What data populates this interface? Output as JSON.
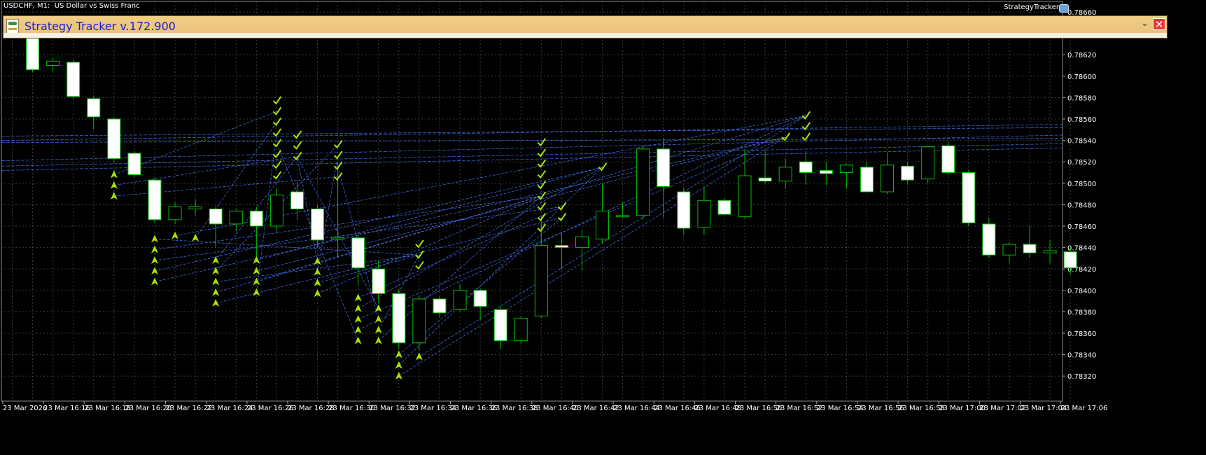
{
  "chart": {
    "symbol_label": "USDCHF, M1:  US Dollar vs Swiss Franc",
    "ea_name": "StrategyTracker",
    "ea_badge": "hat-icon"
  },
  "panel": {
    "title": "Strategy Tracker v.172.900",
    "collapse_icon": "chevron-down-icon",
    "close_icon": "close-icon",
    "close_glyph": "✕",
    "collapse_glyph": "⌄"
  },
  "colors": {
    "background": "#000000",
    "grid": "#3c3c3c",
    "bull_candle": "#00c000",
    "bear_candle": "#ffffff",
    "trade_lines": "#4a78ff",
    "markers": "#a8e400",
    "panel_bg": "#eec47f",
    "panel_title": "#1a1ad0",
    "close_button": "#e53935"
  },
  "chart_data": {
    "type": "candlestick",
    "instrument": "USDCHF",
    "timeframe": "M1",
    "ylim": [
      0.7831,
      0.7867
    ],
    "y_ticks": [
      "0.78660",
      "0.78640",
      "0.78620",
      "0.78600",
      "0.78580",
      "0.78560",
      "0.78540",
      "0.78520",
      "0.78500",
      "0.78480",
      "0.78460",
      "0.78440",
      "0.78420",
      "0.78400",
      "0.78380",
      "0.78360",
      "0.78340",
      "0.78320"
    ],
    "x_ticks": [
      "23 Mar 2026",
      "23 Mar 16:16",
      "23 Mar 16:18",
      "23 Mar 16:20",
      "23 Mar 16:22",
      "23 Mar 16:24",
      "23 Mar 16:26",
      "23 Mar 16:28",
      "23 Mar 16:30",
      "23 Mar 16:32",
      "23 Mar 16:34",
      "23 Mar 16:36",
      "23 Mar 16:38",
      "23 Mar 16:40",
      "23 Mar 16:42",
      "23 Mar 16:44",
      "23 Mar 16:46",
      "23 Mar 16:48",
      "23 Mar 16:50",
      "23 Mar 16:52",
      "23 Mar 16:54",
      "23 Mar 16:56",
      "23 Mar 16:58",
      "23 Mar 17:00",
      "23 Mar 17:02",
      "23 Mar 17:04",
      "23 Mar 17:06"
    ],
    "candles": [
      {
        "o": 0.78642,
        "h": 0.78648,
        "l": 0.78636,
        "c": 0.7864
      },
      {
        "o": 0.7864,
        "h": 0.78645,
        "l": 0.78604,
        "c": 0.78606
      },
      {
        "o": 0.7861,
        "h": 0.78617,
        "l": 0.78604,
        "c": 0.78614
      },
      {
        "o": 0.78613,
        "h": 0.78615,
        "l": 0.78579,
        "c": 0.78581
      },
      {
        "o": 0.78579,
        "h": 0.78582,
        "l": 0.7855,
        "c": 0.78562
      },
      {
        "o": 0.7856,
        "h": 0.78562,
        "l": 0.7852,
        "c": 0.78523
      },
      {
        "o": 0.78528,
        "h": 0.7853,
        "l": 0.78506,
        "c": 0.78508
      },
      {
        "o": 0.78503,
        "h": 0.78505,
        "l": 0.78463,
        "c": 0.78466
      },
      {
        "o": 0.78466,
        "h": 0.78482,
        "l": 0.78462,
        "c": 0.78478
      },
      {
        "o": 0.78476,
        "h": 0.78485,
        "l": 0.7847,
        "c": 0.78478
      },
      {
        "o": 0.78476,
        "h": 0.78478,
        "l": 0.7844,
        "c": 0.78462
      },
      {
        "o": 0.78462,
        "h": 0.78476,
        "l": 0.78455,
        "c": 0.78474
      },
      {
        "o": 0.78474,
        "h": 0.78478,
        "l": 0.7843,
        "c": 0.7846
      },
      {
        "o": 0.7846,
        "h": 0.78495,
        "l": 0.78455,
        "c": 0.78489
      },
      {
        "o": 0.78492,
        "h": 0.78501,
        "l": 0.78466,
        "c": 0.78476
      },
      {
        "o": 0.78476,
        "h": 0.7848,
        "l": 0.7844,
        "c": 0.78447
      },
      {
        "o": 0.78448,
        "h": 0.7852,
        "l": 0.7843,
        "c": 0.78449
      },
      {
        "o": 0.78449,
        "h": 0.78452,
        "l": 0.78404,
        "c": 0.78421
      },
      {
        "o": 0.7842,
        "h": 0.78428,
        "l": 0.78388,
        "c": 0.78397
      },
      {
        "o": 0.78397,
        "h": 0.78401,
        "l": 0.78346,
        "c": 0.78351
      },
      {
        "o": 0.78351,
        "h": 0.78395,
        "l": 0.78344,
        "c": 0.78392
      },
      {
        "o": 0.78392,
        "h": 0.78395,
        "l": 0.78375,
        "c": 0.78379
      },
      {
        "o": 0.78382,
        "h": 0.78406,
        "l": 0.7838,
        "c": 0.784
      },
      {
        "o": 0.784,
        "h": 0.78402,
        "l": 0.78372,
        "c": 0.78385
      },
      {
        "o": 0.78382,
        "h": 0.78385,
        "l": 0.78345,
        "c": 0.78353
      },
      {
        "o": 0.78353,
        "h": 0.78376,
        "l": 0.7835,
        "c": 0.78374
      },
      {
        "o": 0.78376,
        "h": 0.78469,
        "l": 0.78374,
        "c": 0.78442
      },
      {
        "o": 0.78442,
        "h": 0.78454,
        "l": 0.7842,
        "c": 0.7844
      },
      {
        "o": 0.7844,
        "h": 0.78456,
        "l": 0.78418,
        "c": 0.7845
      },
      {
        "o": 0.78448,
        "h": 0.785,
        "l": 0.78444,
        "c": 0.78474
      },
      {
        "o": 0.7847,
        "h": 0.78482,
        "l": 0.78468,
        "c": 0.7847
      },
      {
        "o": 0.7847,
        "h": 0.78534,
        "l": 0.78466,
        "c": 0.78532
      },
      {
        "o": 0.78532,
        "h": 0.78542,
        "l": 0.78468,
        "c": 0.78497
      },
      {
        "o": 0.78492,
        "h": 0.78496,
        "l": 0.78452,
        "c": 0.78458
      },
      {
        "o": 0.78459,
        "h": 0.78497,
        "l": 0.78452,
        "c": 0.78484
      },
      {
        "o": 0.78484,
        "h": 0.78486,
        "l": 0.7847,
        "c": 0.78471
      },
      {
        "o": 0.78469,
        "h": 0.78532,
        "l": 0.78467,
        "c": 0.78507
      },
      {
        "o": 0.78505,
        "h": 0.7853,
        "l": 0.785,
        "c": 0.78502
      },
      {
        "o": 0.78502,
        "h": 0.78523,
        "l": 0.78495,
        "c": 0.78515
      },
      {
        "o": 0.7852,
        "h": 0.7853,
        "l": 0.78499,
        "c": 0.7851
      },
      {
        "o": 0.78512,
        "h": 0.7852,
        "l": 0.78498,
        "c": 0.78509
      },
      {
        "o": 0.7851,
        "h": 0.78518,
        "l": 0.78495,
        "c": 0.78517
      },
      {
        "o": 0.78515,
        "h": 0.7852,
        "l": 0.78495,
        "c": 0.78492
      },
      {
        "o": 0.78492,
        "h": 0.78528,
        "l": 0.7849,
        "c": 0.78517
      },
      {
        "o": 0.78516,
        "h": 0.7852,
        "l": 0.785,
        "c": 0.78503
      },
      {
        "o": 0.78504,
        "h": 0.78534,
        "l": 0.785,
        "c": 0.78534
      },
      {
        "o": 0.78535,
        "h": 0.78539,
        "l": 0.78508,
        "c": 0.7851
      },
      {
        "o": 0.7851,
        "h": 0.78512,
        "l": 0.7846,
        "c": 0.78463
      },
      {
        "o": 0.78462,
        "h": 0.78468,
        "l": 0.7843,
        "c": 0.78433
      },
      {
        "o": 0.78433,
        "h": 0.78445,
        "l": 0.78425,
        "c": 0.78443
      },
      {
        "o": 0.78443,
        "h": 0.7846,
        "l": 0.7843,
        "c": 0.78435
      },
      {
        "o": 0.78435,
        "h": 0.78447,
        "l": 0.78425,
        "c": 0.78437
      },
      {
        "o": 0.78436,
        "h": 0.7844,
        "l": 0.78415,
        "c": 0.78421
      }
    ],
    "buy_arrows": [
      {
        "i": 5,
        "prices": [
          0.78508,
          0.78498,
          0.78488
        ]
      },
      {
        "i": 7,
        "prices": [
          0.78448,
          0.78438,
          0.78428,
          0.78418,
          0.78408
        ]
      },
      {
        "i": 8,
        "prices": [
          0.78451
        ]
      },
      {
        "i": 9,
        "prices": [
          0.78449
        ]
      },
      {
        "i": 10,
        "prices": [
          0.78428,
          0.78418,
          0.78408,
          0.78398,
          0.78388
        ]
      },
      {
        "i": 12,
        "prices": [
          0.78428,
          0.78418,
          0.78408,
          0.78398
        ]
      },
      {
        "i": 15,
        "prices": [
          0.78427,
          0.78417,
          0.78407,
          0.78397
        ]
      },
      {
        "i": 17,
        "prices": [
          0.78393,
          0.78383,
          0.78373,
          0.78363,
          0.78353
        ]
      },
      {
        "i": 18,
        "prices": [
          0.78383,
          0.78373,
          0.78363,
          0.78353
        ]
      },
      {
        "i": 19,
        "prices": [
          0.7834,
          0.7833,
          0.7832
        ]
      },
      {
        "i": 20,
        "prices": [
          0.78338
        ]
      }
    ],
    "check_marks": [
      {
        "i": 13,
        "prices": [
          0.78577,
          0.78567,
          0.78557,
          0.78547,
          0.78537,
          0.78527,
          0.78517,
          0.78507
        ]
      },
      {
        "i": 14,
        "prices": [
          0.78545,
          0.78535,
          0.78525
        ]
      },
      {
        "i": 16,
        "prices": [
          0.78536,
          0.78526,
          0.78516,
          0.78506
        ]
      },
      {
        "i": 20,
        "prices": [
          0.78443,
          0.78433,
          0.78423
        ]
      },
      {
        "i": 26,
        "prices": [
          0.78538,
          0.78528,
          0.78518,
          0.78508,
          0.78498,
          0.78488,
          0.78478,
          0.78468,
          0.78458
        ]
      },
      {
        "i": 27,
        "prices": [
          0.78478,
          0.78468
        ]
      },
      {
        "i": 29,
        "prices": [
          0.78515
        ]
      },
      {
        "i": 38,
        "prices": [
          0.78543
        ]
      },
      {
        "i": 39,
        "prices": [
          0.78563,
          0.78553,
          0.78543
        ]
      }
    ]
  }
}
